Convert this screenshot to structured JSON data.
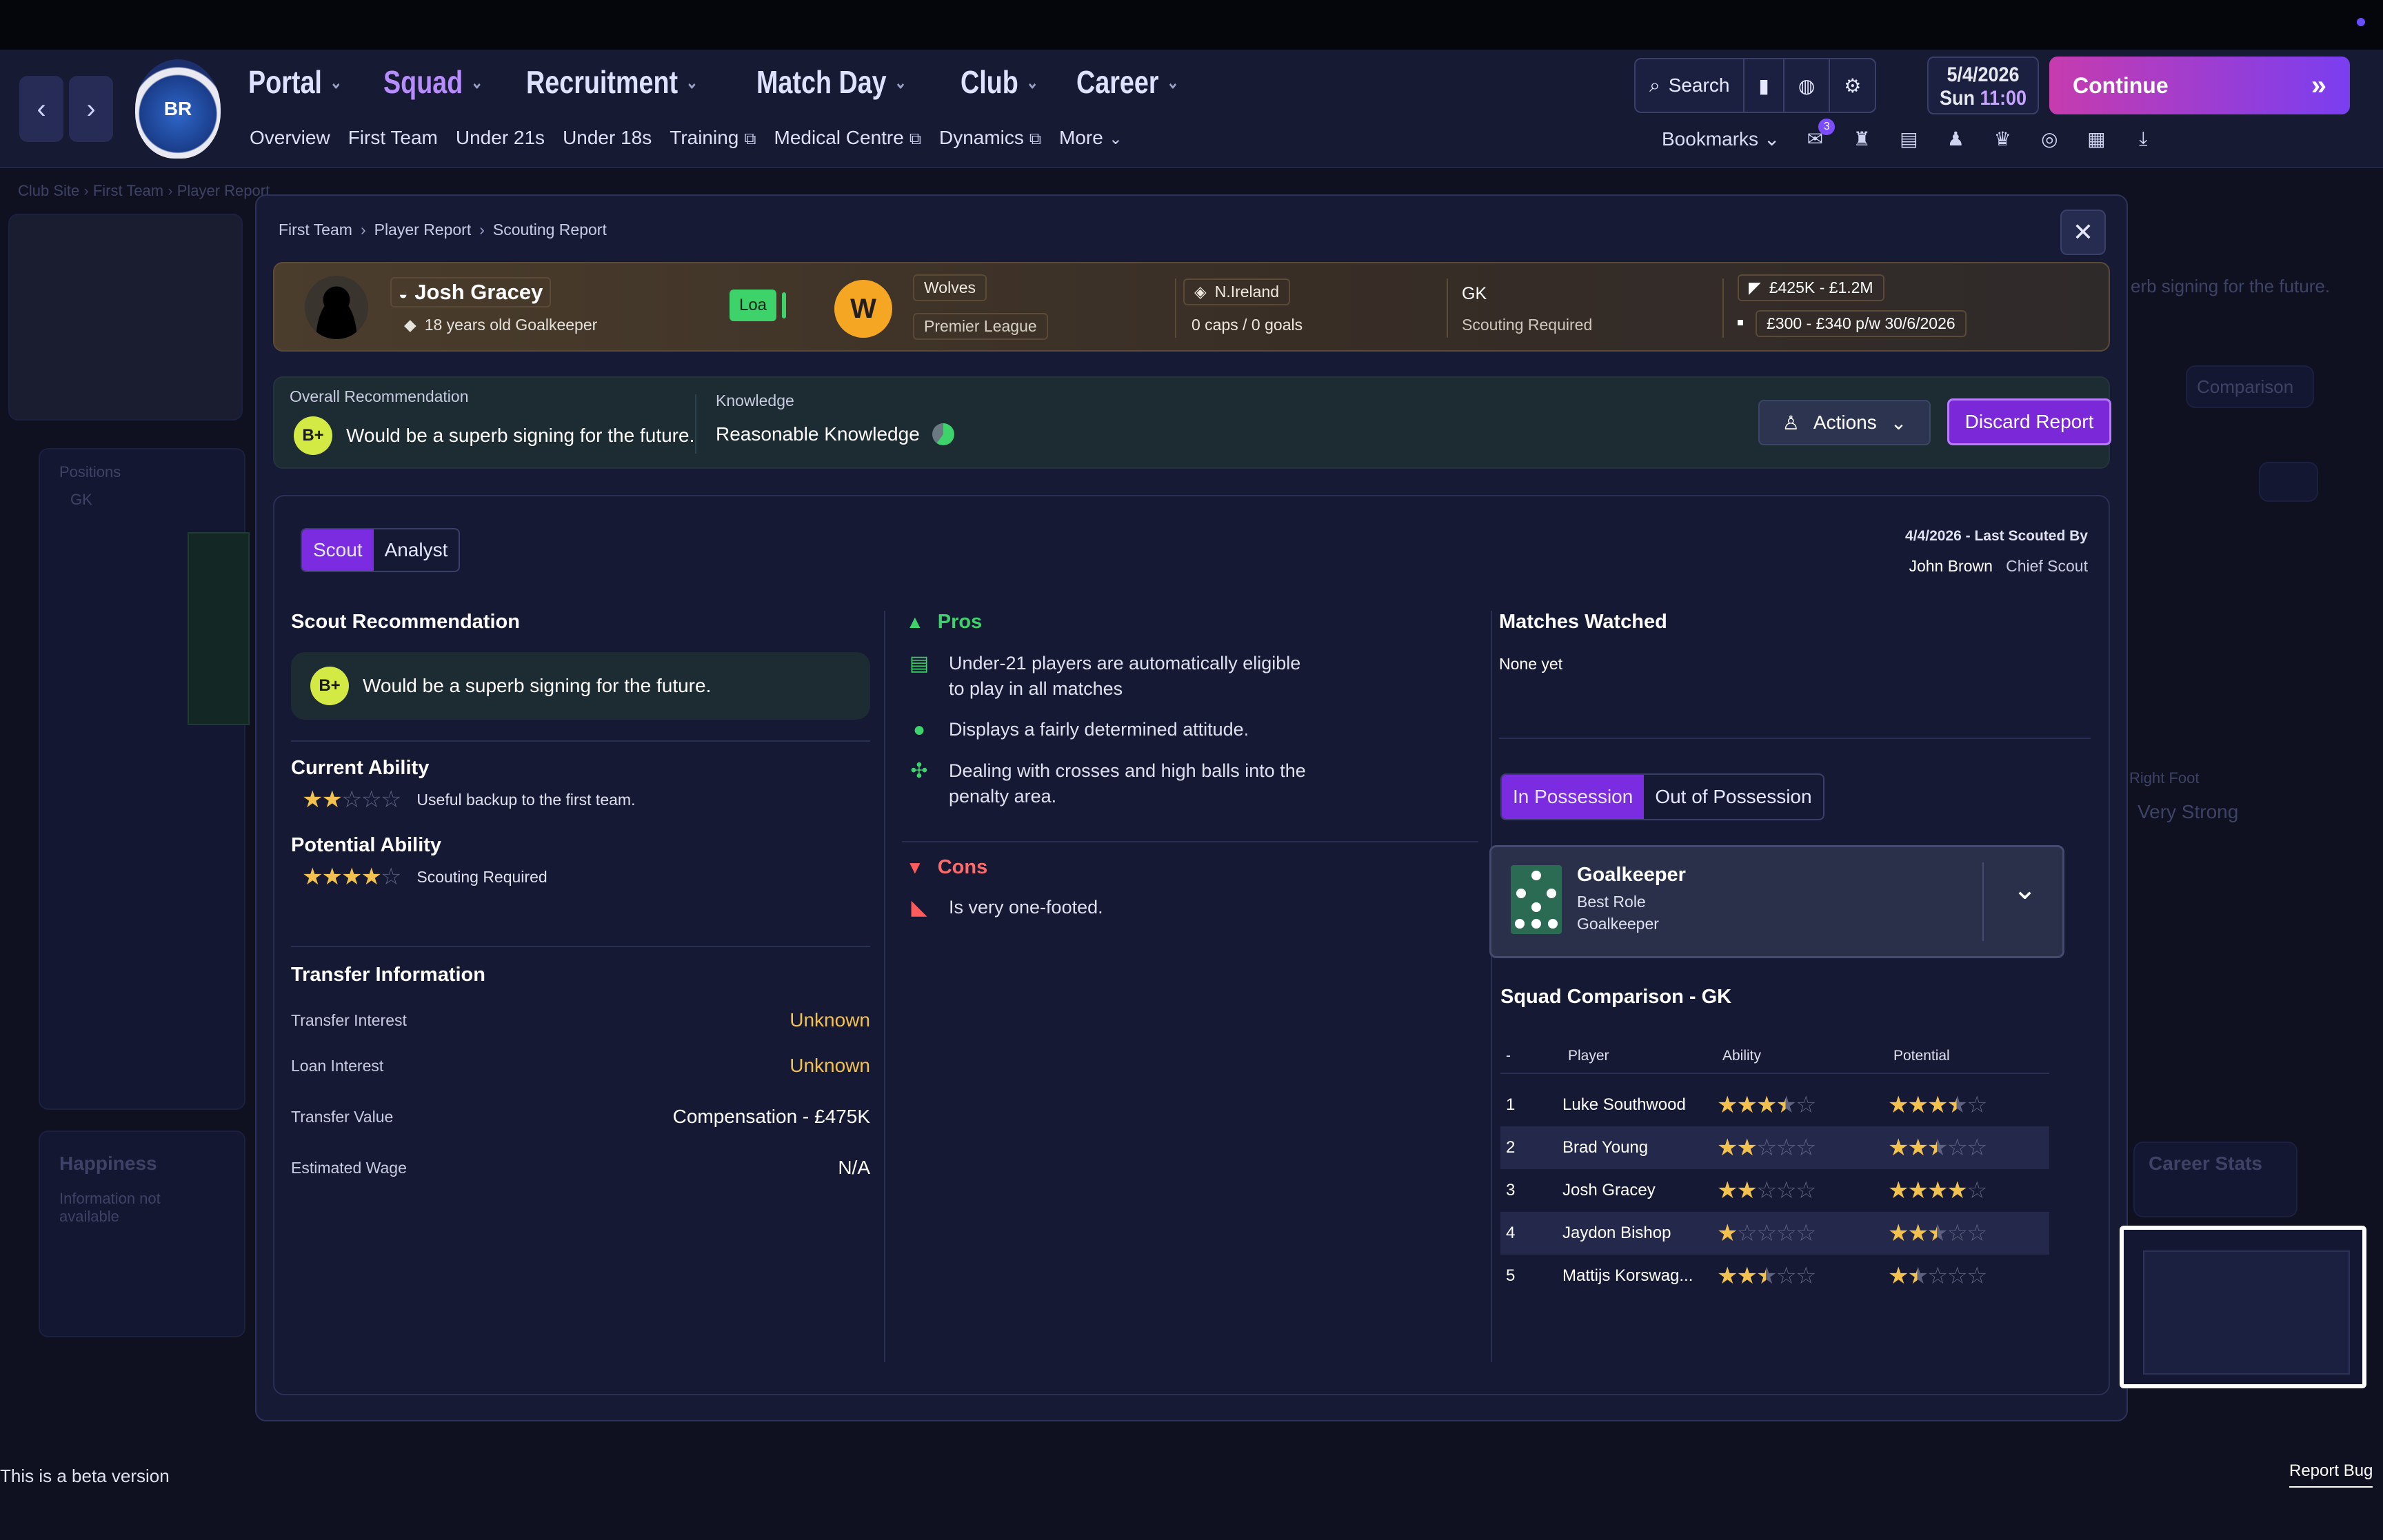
{
  "nav": {
    "main": [
      "Portal",
      "Squad",
      "Recruitment",
      "Match Day",
      "Club",
      "Career"
    ],
    "sub": [
      "Overview",
      "First Team",
      "Under 21s",
      "Under 18s",
      "Training",
      "Medical Centre",
      "Dynamics",
      "More"
    ],
    "search_label": "Search",
    "date": "5/4/2026",
    "day": "Sun",
    "time": "11:00",
    "continue_label": "Continue",
    "bookmarks_label": "Bookmarks",
    "notification_count": "3"
  },
  "background": {
    "breadcrumb": [
      "Club Site",
      "First Team",
      "Player Report"
    ],
    "positions_label": "Positions",
    "position": "GK",
    "happiness_title": "Happiness",
    "happiness_text": "Information not available",
    "rec_snippet": "erb signing for the future.",
    "comparison": "Comparison",
    "right_foot_label": "Right Foot",
    "right_foot_value": "Very Strong",
    "career_stats": "Career Stats"
  },
  "modal": {
    "breadcrumb": [
      "First Team",
      "Player Report",
      "Scouting Report"
    ],
    "player": {
      "name": "Josh Gracey",
      "age_position": "18 years old Goalkeeper",
      "status_badge": "Loa",
      "club": "Wolves",
      "league": "Premier League",
      "nationality": "N.Ireland",
      "caps": "0 caps / 0 goals",
      "position": "GK",
      "position_note": "Scouting Required",
      "value_range": "£425K - £1.2M",
      "wage_contract": "£300 - £340 p/w 30/6/2026"
    },
    "overall": {
      "label": "Overall Recommendation",
      "grade": "B+",
      "text": "Would be a superb signing for the future.",
      "knowledge_label": "Knowledge",
      "knowledge_value": "Reasonable Knowledge",
      "actions_label": "Actions",
      "discard_label": "Discard Report"
    },
    "tabs": [
      "Scout",
      "Analyst"
    ],
    "last_scouted": "4/4/2026 - Last Scouted By",
    "scout_name": "John Brown",
    "scout_role": "Chief Scout",
    "scout_rec": {
      "title": "Scout Recommendation",
      "grade": "B+",
      "text": "Would be a superb signing for the future."
    },
    "current_ability": {
      "title": "Current Ability",
      "stars": 2,
      "note": "Useful backup to the first team."
    },
    "potential_ability": {
      "title": "Potential Ability",
      "stars": 4,
      "note": "Scouting Required"
    },
    "transfer": {
      "title": "Transfer Information",
      "rows": [
        {
          "key": "Transfer Interest",
          "value": "Unknown"
        },
        {
          "key": "Loan Interest",
          "value": "Unknown"
        },
        {
          "key": "Transfer Value",
          "value": "Compensation - £475K"
        },
        {
          "key": "Estimated Wage",
          "value": "N/A"
        }
      ]
    },
    "pros": {
      "title": "Pros",
      "items": [
        [
          "Under-21 players are automatically eligible",
          "to play in all matches"
        ],
        [
          "Displays a fairly determined attitude."
        ],
        [
          "Dealing with crosses and high balls into the",
          "penalty area."
        ]
      ]
    },
    "cons": {
      "title": "Cons",
      "items": [
        "Is very one-footed."
      ]
    },
    "matches": {
      "title": "Matches Watched",
      "value": "None yet"
    },
    "possession_tabs": [
      "In Possession",
      "Out of Possession"
    ],
    "role": {
      "name": "Goalkeeper",
      "label": "Best Role",
      "value": "Goalkeeper"
    },
    "squad_comparison": {
      "title": "Squad Comparison - GK",
      "headers": [
        "-",
        "Player",
        "Ability",
        "Potential"
      ],
      "rows": [
        {
          "rank": "1",
          "player": "Luke Southwood",
          "ability": 3.5,
          "potential": 3.5
        },
        {
          "rank": "2",
          "player": "Brad Young",
          "ability": 2,
          "potential": 2.5
        },
        {
          "rank": "3",
          "player": "Josh Gracey",
          "ability": 2,
          "potential": 4
        },
        {
          "rank": "4",
          "player": "Jaydon Bishop",
          "ability": 1,
          "potential": 2.5
        },
        {
          "rank": "5",
          "player": "Mattijs Korswag...",
          "ability": 2.5,
          "potential": 1.5
        }
      ]
    }
  },
  "footer": {
    "beta": "This is a beta version",
    "report_bug": "Report Bug"
  }
}
